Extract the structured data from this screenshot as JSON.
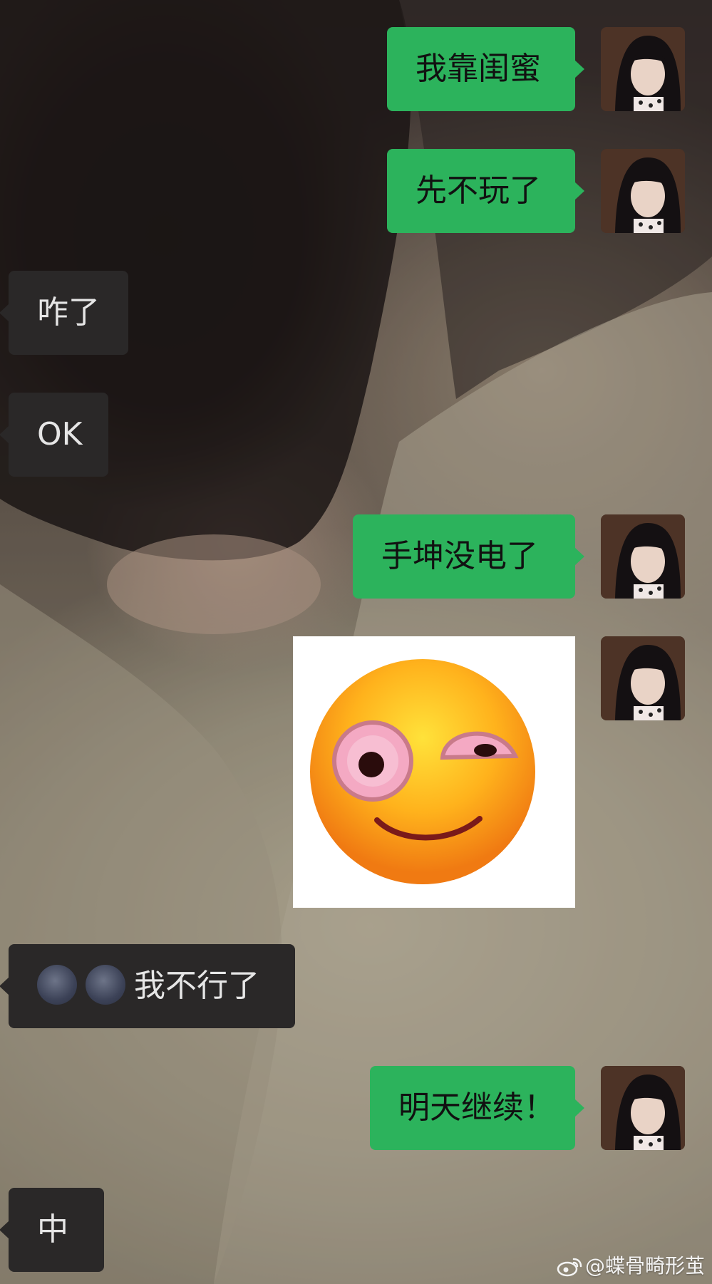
{
  "chat": {
    "messages": [
      {
        "sender": "me",
        "type": "text",
        "text": "我靠闺蜜"
      },
      {
        "sender": "me",
        "type": "text",
        "text": "先不玩了"
      },
      {
        "sender": "other",
        "type": "text",
        "text": "咋了"
      },
      {
        "sender": "other",
        "type": "text",
        "text": "OK"
      },
      {
        "sender": "me",
        "type": "text",
        "text": "手坤没电了"
      },
      {
        "sender": "me",
        "type": "sticker",
        "sticker": "rolling-eye-smile-emoji"
      },
      {
        "sender": "other",
        "type": "text",
        "emoji": [
          "new-moon-face",
          "new-moon-face"
        ],
        "text": "我不行了"
      },
      {
        "sender": "me",
        "type": "text",
        "text": "明天继续！"
      },
      {
        "sender": "other",
        "type": "text",
        "text": "中"
      }
    ]
  },
  "watermark": {
    "icon": "weibo-icon",
    "text": "@蝶骨畸形茧"
  },
  "colors": {
    "my_bubble": "#2cb35c",
    "their_bubble": "#2a2828"
  }
}
